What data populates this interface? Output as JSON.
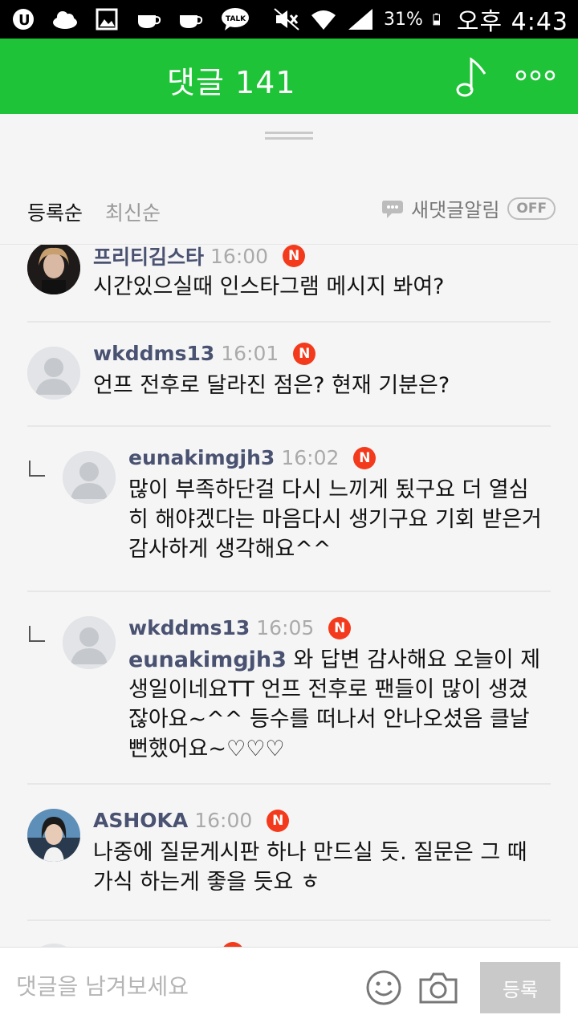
{
  "status_bar": {
    "battery_percent": "31%",
    "time": "오후 4:43"
  },
  "header": {
    "title": "댓글 141"
  },
  "sort": {
    "by_registration": "등록순",
    "latest": "최신순"
  },
  "notify": {
    "label": "새댓글알림",
    "state": "OFF"
  },
  "comments": [
    {
      "nick": "프리티김스타",
      "time": "16:00",
      "badge": "N",
      "text": "시간있으실때 인스타그램 메시지 봐여?",
      "reply": false,
      "avatar": "photo-dark"
    },
    {
      "nick": "wkddms13",
      "time": "16:01",
      "badge": "N",
      "text": "언프 전후로 달라진 점은? 현재 기분은?",
      "reply": false,
      "avatar": "default"
    },
    {
      "nick": "eunakimgjh3",
      "time": "16:02",
      "badge": "N",
      "text": "많이 부족하단걸 다시 느끼게 됬구요 더 열심히 해야겠다는 마음다시 생기구요 기회 받은거 감사하게 생각해요^^",
      "reply": true,
      "avatar": "default"
    },
    {
      "nick": "wkddms13",
      "time": "16:05",
      "badge": "N",
      "mention": "eunakimgjh3",
      "text": " 와 답변 감사해요 오늘이 제 생일이네요TT 언프 전후로 팬들이 많이 생겼잖아요~^^ 등수를 떠나서 안나오셨음 클날뻔했어요~♡♡♡",
      "reply": true,
      "avatar": "default"
    },
    {
      "nick": "ASHOKA",
      "time": "16:00",
      "badge": "N",
      "text": "나중에 질문게시판 하나 만드실 듯. 질문은 그 때 가식 하는게 좋을 듯요 ㅎ",
      "reply": false,
      "avatar": "photo-blue"
    }
  ],
  "input": {
    "placeholder": "댓글을 남겨보세요",
    "submit_label": "등록"
  }
}
